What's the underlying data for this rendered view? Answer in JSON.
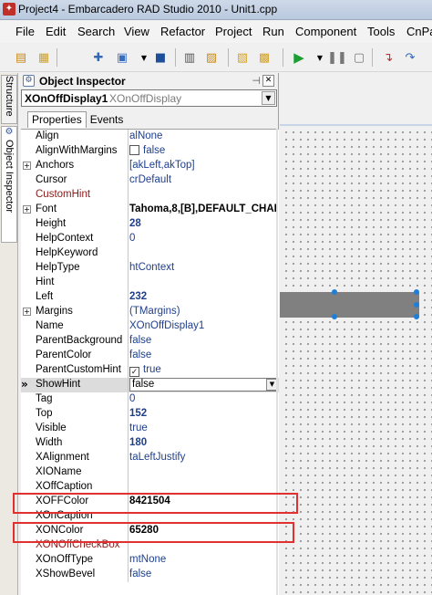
{
  "window": {
    "title": "Project4 - Embarcadero RAD Studio 2010 - Unit1.cpp"
  },
  "menu": [
    "File",
    "Edit",
    "Search",
    "View",
    "Refactor",
    "Project",
    "Run",
    "Component",
    "Tools",
    "CnPa"
  ],
  "side_tabs": {
    "structure": "Structure",
    "object_inspector": "Object Inspector"
  },
  "inspector": {
    "title": "Object Inspector",
    "selected_component": {
      "name": "XOnOffDisplay1",
      "type": "XOnOffDisplay"
    },
    "tabs": [
      "Properties",
      "Events"
    ],
    "properties": [
      {
        "name": "Align",
        "value": "alNone"
      },
      {
        "name": "AlignWithMargins",
        "value": "false",
        "checkbox": false
      },
      {
        "name": "Anchors",
        "value": "[akLeft,akTop]",
        "expandable": true
      },
      {
        "name": "Cursor",
        "value": "crDefault"
      },
      {
        "name": "CustomHint",
        "value": "",
        "event_style": true
      },
      {
        "name": "Font",
        "value": "Tahoma,8,[B],DEFAULT_CHAI",
        "expandable": true
      },
      {
        "name": "Height",
        "value": "28"
      },
      {
        "name": "HelpContext",
        "value": "0"
      },
      {
        "name": "HelpKeyword",
        "value": ""
      },
      {
        "name": "HelpType",
        "value": "htContext"
      },
      {
        "name": "Hint",
        "value": ""
      },
      {
        "name": "Left",
        "value": "232"
      },
      {
        "name": "Margins",
        "value": "(TMargins)",
        "expandable": true
      },
      {
        "name": "Name",
        "value": "XOnOffDisplay1"
      },
      {
        "name": "ParentBackground",
        "value": "false"
      },
      {
        "name": "ParentColor",
        "value": "false"
      },
      {
        "name": "ParentCustomHint",
        "value": "true",
        "checkbox": true
      },
      {
        "name": "ShowHint",
        "value": "false",
        "selected": true
      },
      {
        "name": "Tag",
        "value": "0"
      },
      {
        "name": "Top",
        "value": "152"
      },
      {
        "name": "Visible",
        "value": "true"
      },
      {
        "name": "Width",
        "value": "180"
      },
      {
        "name": "XAlignment",
        "value": "taLeftJustify"
      },
      {
        "name": "XIOName",
        "value": ""
      },
      {
        "name": "XOffCaption",
        "value": ""
      },
      {
        "name": "XOFFColor",
        "value": "8421504"
      },
      {
        "name": "XOnCaption",
        "value": ""
      },
      {
        "name": "XONColor",
        "value": "65280"
      },
      {
        "name": "XONOffCheckBox",
        "value": "",
        "event_style": true
      },
      {
        "name": "XOnOffType",
        "value": "mtNone"
      },
      {
        "name": "XShowBevel",
        "value": "false"
      }
    ]
  },
  "colors": {
    "highlight_box": "#e03030",
    "component_fill": "#808080",
    "handle": "#1f7ed8"
  },
  "icons": [
    "new-file-icon",
    "open-icon",
    "save-icon",
    "save-all-icon",
    "open-project-icon",
    "run-icon",
    "pause-icon",
    "stop-icon",
    "step-icon"
  ]
}
